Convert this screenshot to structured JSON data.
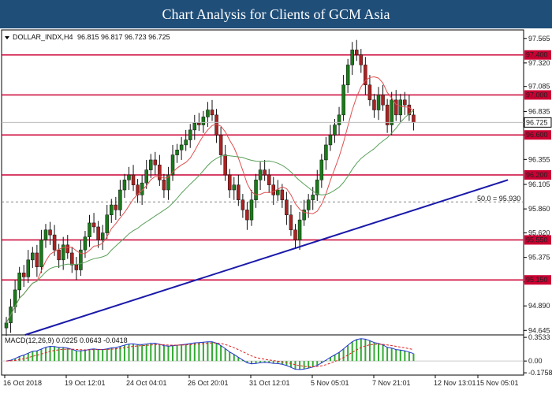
{
  "header": {
    "title": "Chart Analysis for Clients of GCM Asia"
  },
  "chart_data": {
    "type": "candlestick",
    "symbol_label": "DOLLAR_INDX,H4",
    "ohlc_label": "96.815 96.817 96.723 96.725",
    "y_ticks": [
      97.565,
      97.32,
      97.085,
      96.835,
      96.6,
      96.355,
      96.105,
      95.86,
      95.62,
      95.375,
      95.13,
      94.89,
      94.645
    ],
    "ylim": [
      94.6,
      97.65
    ],
    "x_ticks": [
      "16 Oct 2018",
      "19 Oct 12:01",
      "24 Oct 04:01",
      "26 Oct 20:01",
      "31 Oct 12:01",
      "5 Nov 05:01",
      "7 Nov 21:01",
      "12 Nov 13:01",
      "15 Nov 05:01"
    ],
    "current_price": "96.725",
    "levels": [
      {
        "value": 97.4,
        "label": "97.400"
      },
      {
        "value": 97.0,
        "label": "97.000"
      },
      {
        "value": 96.6,
        "label": "96.600"
      },
      {
        "value": 96.2,
        "label": "96.200"
      },
      {
        "value": 95.55,
        "label": "95.550"
      },
      {
        "value": 95.15,
        "label": "95.150"
      }
    ],
    "fib_label": "50.0 = 95.930",
    "fib_value": 95.93,
    "trendline": {
      "start": [
        0.045,
        94.6
      ],
      "end": [
        0.97,
        96.15
      ]
    },
    "closes": [
      94.72,
      94.88,
      95.05,
      95.22,
      95.18,
      95.35,
      95.42,
      95.28,
      95.55,
      95.65,
      95.6,
      95.45,
      95.35,
      95.5,
      95.42,
      95.3,
      95.25,
      95.45,
      95.58,
      95.72,
      95.68,
      95.55,
      95.62,
      95.8,
      95.9,
      95.85,
      96.05,
      96.15,
      96.2,
      96.1,
      96.0,
      96.12,
      96.25,
      96.35,
      96.3,
      96.15,
      96.05,
      96.2,
      96.4,
      96.45,
      96.5,
      96.55,
      96.65,
      96.72,
      96.7,
      96.78,
      96.85,
      96.8,
      96.6,
      96.4,
      96.2,
      96.05,
      96.1,
      95.95,
      95.85,
      95.75,
      95.95,
      96.15,
      96.25,
      96.2,
      96.1,
      96.0,
      96.05,
      95.95,
      95.8,
      95.65,
      95.55,
      95.75,
      95.85,
      95.95,
      96.0,
      96.15,
      96.35,
      96.5,
      96.6,
      96.7,
      96.8,
      97.1,
      97.3,
      97.45,
      97.4,
      97.3,
      97.1,
      96.95,
      96.85,
      97.0,
      96.9,
      96.7,
      96.95,
      96.8,
      96.95,
      96.9,
      96.8,
      96.725
    ],
    "sma_fast_name": "MA fast",
    "sma_slow_name": "MA slow",
    "macd": {
      "label": "MACD(12,26,9) 0.0225 0.0643 -0.0418",
      "y_ticks": [
        0.3533,
        0.0,
        -0.1758
      ],
      "y_tick_labels": [
        "0.3533",
        "0.00",
        "-0.1758"
      ],
      "ylim": [
        -0.21,
        0.39
      ]
    },
    "colors": {
      "title_bg": "#1f4e79",
      "levels": "#cc0033",
      "trendline": "#1a1aaa",
      "bull": "#1a7a1a",
      "bear": "#aa2222",
      "ma_fast": "#e05050",
      "ma_slow": "#5aa05a",
      "macd_line": "#2233cc",
      "signal_line": "#dd2222",
      "hist": "#33aa33"
    }
  }
}
